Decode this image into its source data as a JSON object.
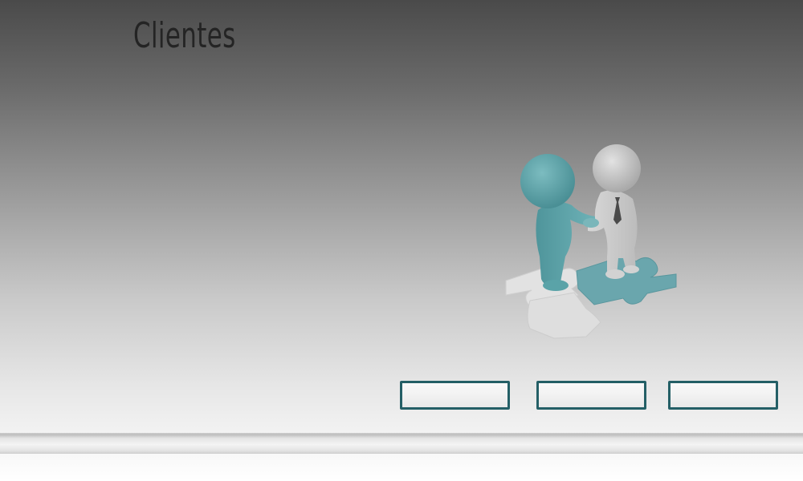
{
  "page": {
    "title": "Clientes"
  },
  "illustration": {
    "icon": "handshake-puzzle-icon",
    "colors": {
      "teal_figure": "#5aa3a8",
      "grey_figure": "#c4c4c4",
      "puzzle_teal": "#6aa6ad",
      "puzzle_white": "#e4e4e4"
    }
  },
  "buttons": [
    {
      "label": ""
    },
    {
      "label": ""
    },
    {
      "label": ""
    }
  ],
  "colors": {
    "button_border": "#245f66",
    "title": "#242424"
  }
}
